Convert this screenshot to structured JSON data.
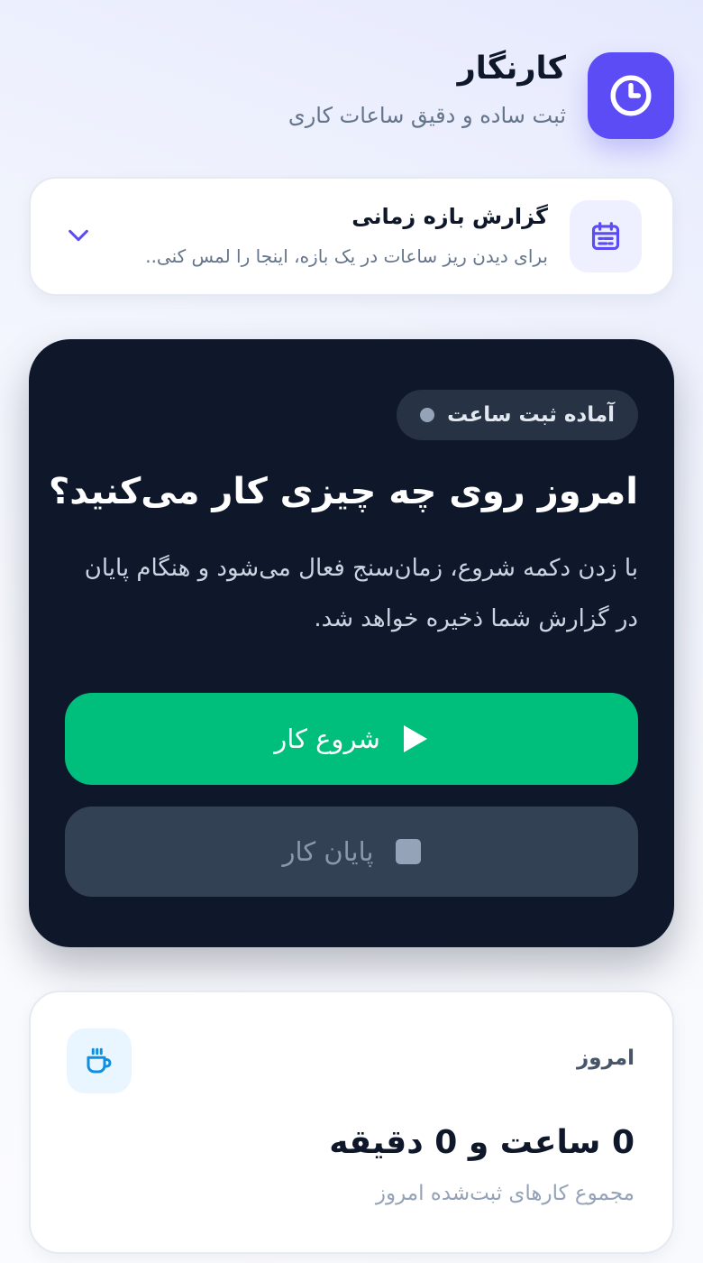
{
  "app": {
    "title": "کارنگار",
    "subtitle": "ثبت ساده و دقیق ساعات کاری",
    "icon": "clock-icon",
    "accent_color": "#5b4cf5"
  },
  "range_report": {
    "title": "گزارش بازه زمانی",
    "hint": "برای دیدن ریز ساعات در یک بازه، اینجا را لمس کنی..",
    "icon": "calendar-icon",
    "toggle_icon": "chevron-down-icon"
  },
  "timer": {
    "status": "آماده ثبت ساعت",
    "status_dot_color": "#94a3b8",
    "heading": "امروز روی چه چیزی کار می‌کنید؟",
    "description": "با زدن دکمه شروع، زمان‌سنج فعال می‌شود و هنگام پایان در گزارش شما ذخیره خواهد شد.",
    "start_label": "شروع کار",
    "start_icon": "play-icon",
    "start_color": "#00bf7d",
    "stop_label": "پایان کار",
    "stop_icon": "stop-icon"
  },
  "today": {
    "label": "امروز",
    "total": "0 ساعت و 0 دقیقه",
    "caption": "مجموع کارهای ثبت‌شده امروز",
    "icon": "coffee-cup-icon"
  }
}
